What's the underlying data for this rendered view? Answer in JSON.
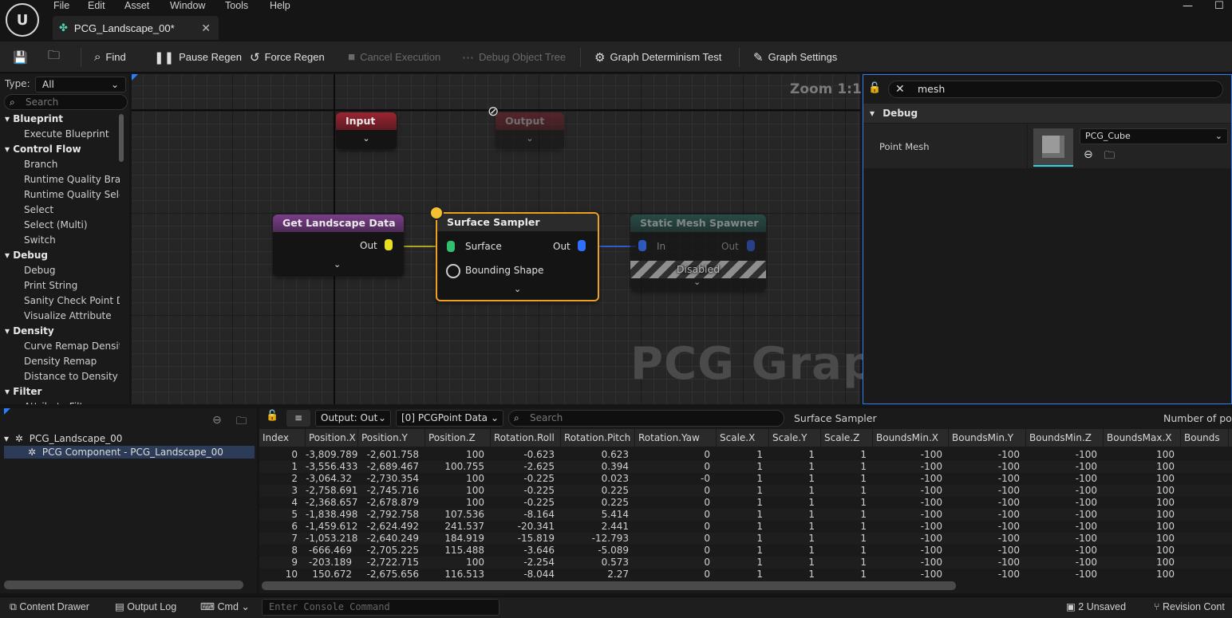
{
  "menu": [
    "File",
    "Edit",
    "Asset",
    "Window",
    "Tools",
    "Help"
  ],
  "document_tab": "PCG_Landscape_00*",
  "toolbar": {
    "find": "Find",
    "pause_regen": "Pause Regen",
    "force_regen": "Force Regen",
    "cancel_execution": "Cancel Execution",
    "debug_object_tree": "Debug Object Tree",
    "graph_determinism_test": "Graph Determinism Test",
    "graph_settings": "Graph Settings"
  },
  "palette": {
    "type_label": "Type:",
    "type_value": "All",
    "search_placeholder": "Search",
    "rows": [
      {
        "kind": "cat",
        "label": "Blueprint"
      },
      {
        "kind": "item",
        "label": "Execute Blueprint"
      },
      {
        "kind": "cat",
        "label": "Control Flow"
      },
      {
        "kind": "item",
        "label": "Branch"
      },
      {
        "kind": "item",
        "label": "Runtime Quality Bra"
      },
      {
        "kind": "item",
        "label": "Runtime Quality Sele"
      },
      {
        "kind": "item",
        "label": "Select"
      },
      {
        "kind": "item",
        "label": "Select (Multi)"
      },
      {
        "kind": "item",
        "label": "Switch"
      },
      {
        "kind": "cat",
        "label": "Debug"
      },
      {
        "kind": "item",
        "label": "Debug"
      },
      {
        "kind": "item",
        "label": "Print String"
      },
      {
        "kind": "item",
        "label": "Sanity Check Point D"
      },
      {
        "kind": "item",
        "label": "Visualize Attribute"
      },
      {
        "kind": "cat",
        "label": "Density"
      },
      {
        "kind": "item",
        "label": "Curve Remap Densit"
      },
      {
        "kind": "item",
        "label": "Density Remap"
      },
      {
        "kind": "item",
        "label": "Distance to Density"
      },
      {
        "kind": "cat",
        "label": "Filter"
      },
      {
        "kind": "item",
        "label": "Attribute Filter"
      }
    ]
  },
  "graph": {
    "zoom": "Zoom 1:1",
    "watermark": "PCG Graph",
    "nodes": {
      "input": {
        "title": "Input"
      },
      "output": {
        "title": "Output"
      },
      "get_landscape": {
        "title": "Get Landscape Data",
        "out": "Out"
      },
      "surface_sampler": {
        "title": "Surface Sampler",
        "in1": "Surface",
        "in2": "Bounding Shape",
        "out": "Out"
      },
      "static_mesh_spawner": {
        "title": "Static Mesh Spawner",
        "in": "In",
        "out": "Out",
        "status": "Disabled"
      }
    }
  },
  "details": {
    "search_value": "mesh",
    "category": "Debug",
    "point_mesh_label": "Point Mesh",
    "point_mesh_value": "PCG_Cube"
  },
  "tree": {
    "root": "PCG_Landscape_00",
    "child": "PCG Component - PCG_Landscape_00"
  },
  "attributes": {
    "output_dropdown": "Output: Out",
    "data_dropdown": "[0] PCGPoint Data",
    "search_placeholder": "Search",
    "node_name": "Surface Sampler",
    "points_label": "Number of poin",
    "columns": [
      "Index",
      "Position.X",
      "Position.Y",
      "Position.Z",
      "Rotation.Roll",
      "Rotation.Pitch",
      "Rotation.Yaw",
      "Scale.X",
      "Scale.Y",
      "Scale.Z",
      "BoundsMin.X",
      "BoundsMin.Y",
      "BoundsMin.Z",
      "BoundsMax.X",
      "Bounds"
    ],
    "rows": [
      [
        "0",
        "-3,809.789",
        "-2,601.758",
        "100",
        "-0.623",
        "0.623",
        "0",
        "1",
        "1",
        "1",
        "-100",
        "-100",
        "-100",
        "100",
        ""
      ],
      [
        "1",
        "-3,556.433",
        "-2,689.467",
        "100.755",
        "-2.625",
        "0.394",
        "0",
        "1",
        "1",
        "1",
        "-100",
        "-100",
        "-100",
        "100",
        ""
      ],
      [
        "2",
        "-3,064.32",
        "-2,730.354",
        "100",
        "-0.225",
        "0.023",
        "-0",
        "1",
        "1",
        "1",
        "-100",
        "-100",
        "-100",
        "100",
        ""
      ],
      [
        "3",
        "-2,758.691",
        "-2,745.716",
        "100",
        "-0.225",
        "0.225",
        "0",
        "1",
        "1",
        "1",
        "-100",
        "-100",
        "-100",
        "100",
        ""
      ],
      [
        "4",
        "-2,368.657",
        "-2,678.879",
        "100",
        "-0.225",
        "0.225",
        "0",
        "1",
        "1",
        "1",
        "-100",
        "-100",
        "-100",
        "100",
        ""
      ],
      [
        "5",
        "-1,838.498",
        "-2,792.758",
        "107.536",
        "-8.164",
        "5.414",
        "0",
        "1",
        "1",
        "1",
        "-100",
        "-100",
        "-100",
        "100",
        ""
      ],
      [
        "6",
        "-1,459.612",
        "-2,624.492",
        "241.537",
        "-20.341",
        "2.441",
        "0",
        "1",
        "1",
        "1",
        "-100",
        "-100",
        "-100",
        "100",
        ""
      ],
      [
        "7",
        "-1,053.218",
        "-2,640.249",
        "184.919",
        "-15.819",
        "-12.793",
        "0",
        "1",
        "1",
        "1",
        "-100",
        "-100",
        "-100",
        "100",
        ""
      ],
      [
        "8",
        "-666.469",
        "-2,705.225",
        "115.488",
        "-3.646",
        "-5.089",
        "0",
        "1",
        "1",
        "1",
        "-100",
        "-100",
        "-100",
        "100",
        ""
      ],
      [
        "9",
        "-203.189",
        "-2,722.715",
        "100",
        "-2.254",
        "0.573",
        "0",
        "1",
        "1",
        "1",
        "-100",
        "-100",
        "-100",
        "100",
        ""
      ],
      [
        "10",
        "150.672",
        "-2,675.656",
        "116.513",
        "-8.044",
        "2.27",
        "0",
        "1",
        "1",
        "1",
        "-100",
        "-100",
        "-100",
        "100",
        ""
      ]
    ]
  },
  "statusbar": {
    "content_drawer": "Content Drawer",
    "output_log": "Output Log",
    "cmd": "Cmd",
    "console_placeholder": "Enter Console Command",
    "unsaved": "2 Unsaved",
    "revision_control": "Revision Cont"
  },
  "colors": {
    "accent_blue": "#2a7fff",
    "selection_orange": "#f0a020",
    "pin_yellow": "#e8e020",
    "pin_green": "#30c070",
    "pin_blue": "#3070ff"
  }
}
